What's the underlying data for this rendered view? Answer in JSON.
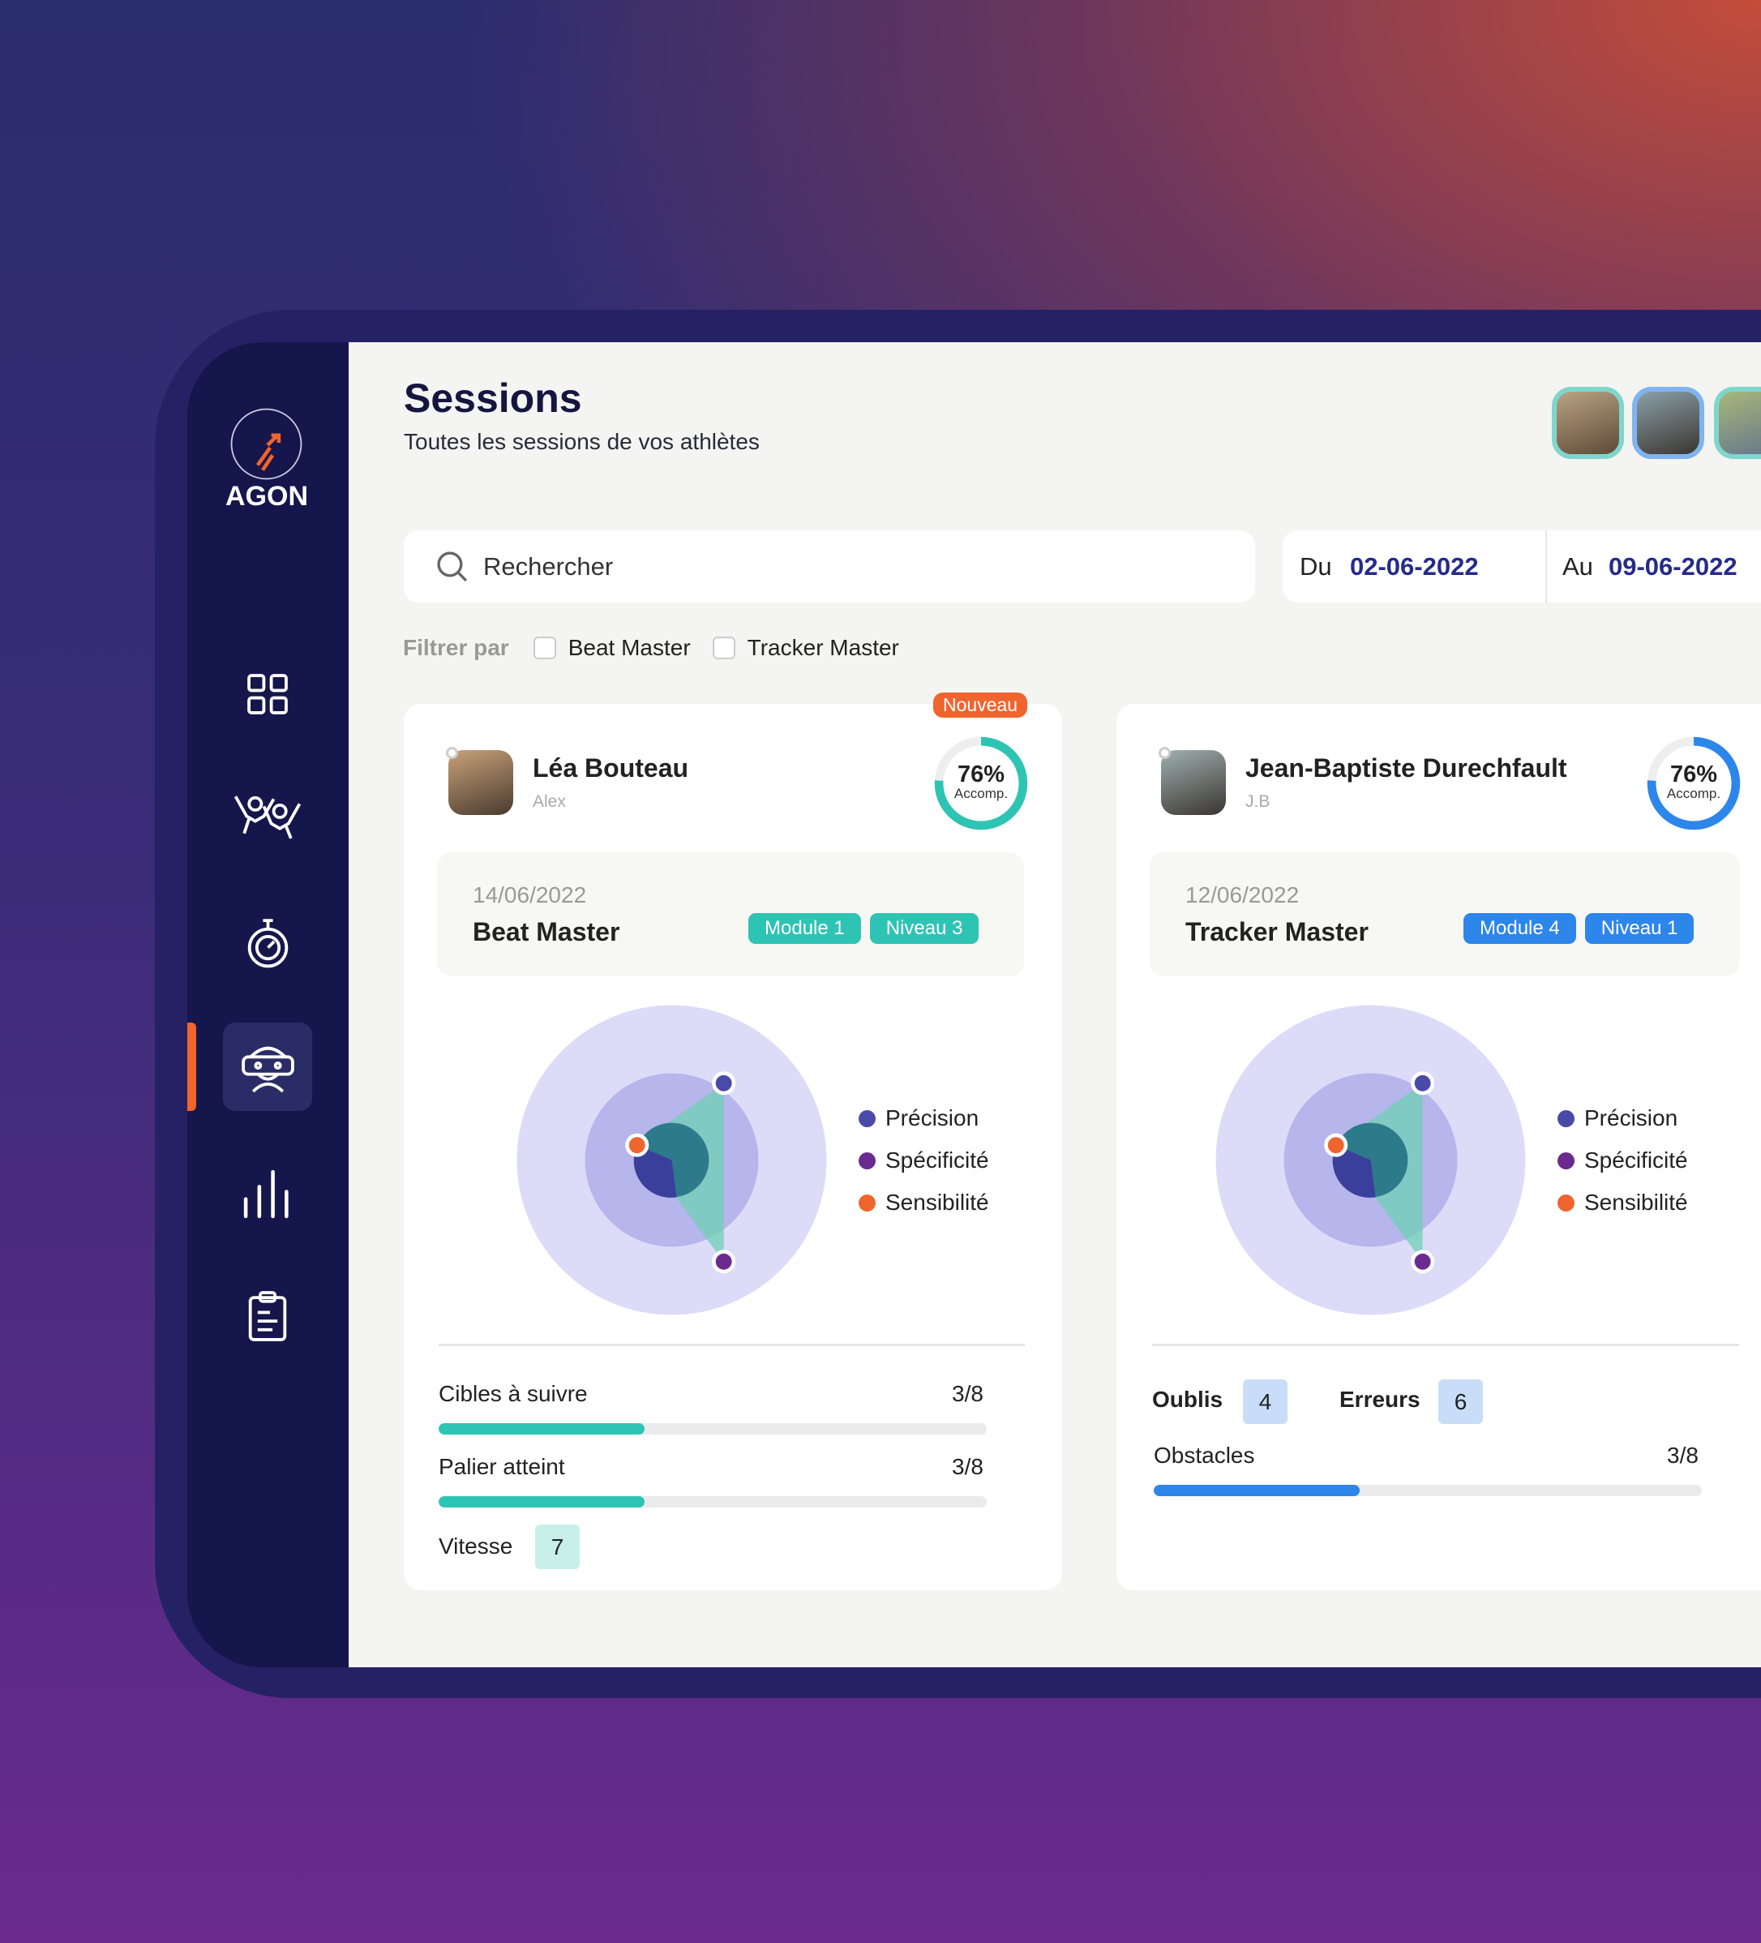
{
  "app": {
    "brand": "AGON"
  },
  "colors": {
    "teal": "#2ec4b4",
    "blue": "#2d86ea",
    "orange": "#f0642e",
    "navy": "#15164b",
    "precision": "#4a4aa8",
    "specificite": "#6a2a90",
    "sensibilite": "#f0642e"
  },
  "sidebar": {
    "items": [
      {
        "icon": "grid-icon"
      },
      {
        "icon": "athletes-icon"
      },
      {
        "icon": "stopwatch-icon"
      },
      {
        "icon": "vr-headset-icon",
        "active": true
      },
      {
        "icon": "bar-chart-icon"
      },
      {
        "icon": "clipboard-icon"
      }
    ]
  },
  "header": {
    "title": "Sessions",
    "subtitle": "Toutes les sessions de vos athlètes"
  },
  "search": {
    "placeholder": "Rechercher"
  },
  "dates": {
    "from_label": "Du",
    "from": "02-06-2022",
    "to_label": "Au",
    "to": "09-06-2022"
  },
  "filter": {
    "label": "Filtrer par",
    "options": [
      {
        "label": "Beat Master",
        "checked": false
      },
      {
        "label": "Tracker Master",
        "checked": false
      }
    ]
  },
  "legend": [
    "Précision",
    "Spécificité",
    "Sensibilité"
  ],
  "cards": [
    {
      "badge": "Nouveau",
      "name": "Léa Bouteau",
      "nickname": "Alex",
      "completion": 76,
      "completion_text": "76%",
      "completion_label": "Accomp.",
      "date": "14/06/2022",
      "game": "Beat Master",
      "module": "Module 1",
      "level": "Niveau 3",
      "stats": [
        {
          "label": "Cibles à suivre",
          "value": "3/8",
          "fraction": 0.375
        },
        {
          "label": "Palier atteint",
          "value": "3/8",
          "fraction": 0.375
        }
      ],
      "vitesse_label": "Vitesse",
      "vitesse": "7"
    },
    {
      "name": "Jean-Baptiste Durechfault",
      "nickname": "J.B",
      "completion": 76,
      "completion_text": "76%",
      "completion_label": "Accomp.",
      "date": "12/06/2022",
      "game": "Tracker Master",
      "module": "Module 4",
      "level": "Niveau 1",
      "oublis_label": "Oublis",
      "oublis": "4",
      "erreurs_label": "Erreurs",
      "erreurs": "6",
      "stats": [
        {
          "label": "Obstacles",
          "value": "3/8",
          "fraction": 0.375
        }
      ]
    }
  ]
}
